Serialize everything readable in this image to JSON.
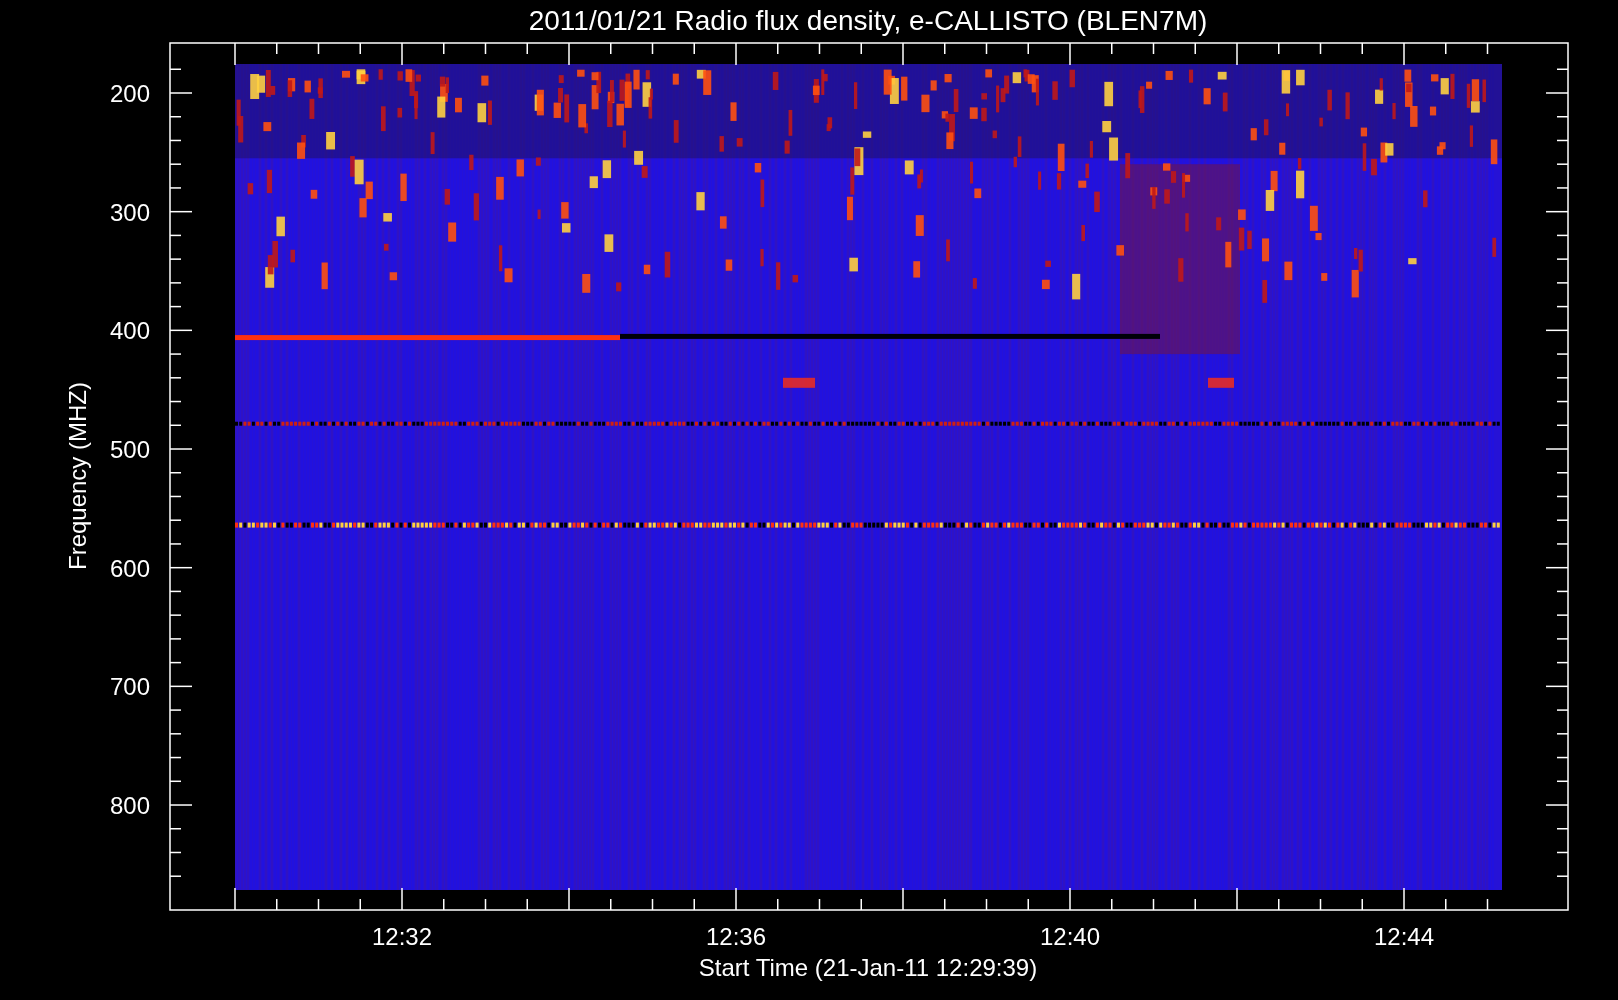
{
  "chart": {
    "title": "2011/01/21  Radio flux density, e-CALLISTO (BLEN7M)",
    "ylabel": "Frequency (MHZ)",
    "yticks": [
      "200",
      "300",
      "400",
      "500",
      "600",
      "700",
      "800"
    ],
    "xlabel": "Start Time (21-Jan-11 12:29:39)",
    "xticks": [
      "12:32",
      "12:36",
      "12:40",
      "12:44"
    ]
  }
}
